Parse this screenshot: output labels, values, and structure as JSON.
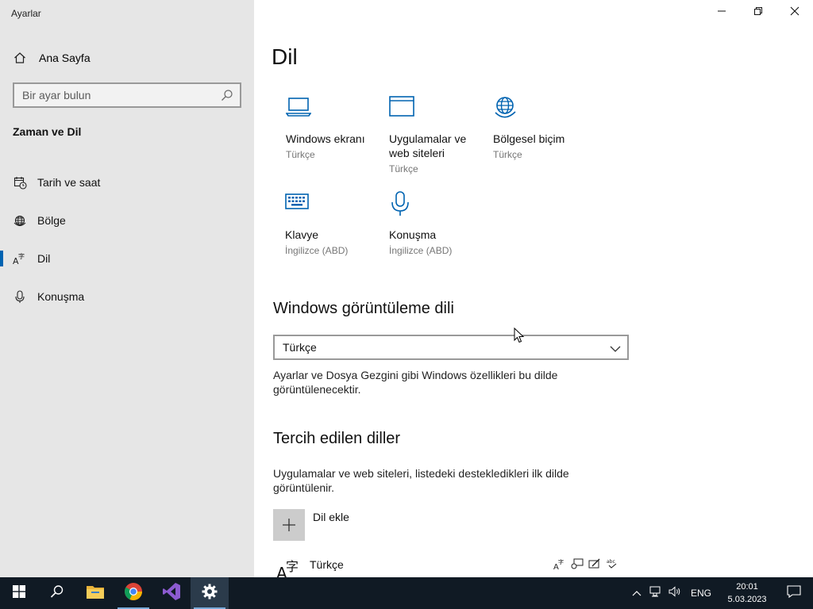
{
  "window": {
    "app_title": "Ayarlar",
    "controls": {
      "minimize_icon": "minimize-icon",
      "restore_icon": "restore-icon",
      "close_icon": "close-icon"
    }
  },
  "sidebar": {
    "home_label": "Ana Sayfa",
    "search_placeholder": "Bir ayar bulun",
    "section_title": "Zaman ve Dil",
    "items": [
      {
        "label": "Tarih ve saat",
        "icon": "date-time-icon",
        "active": false
      },
      {
        "label": "Bölge",
        "icon": "region-globe-icon",
        "active": false
      },
      {
        "label": "Dil",
        "icon": "language-icon",
        "active": true
      },
      {
        "label": "Konuşma",
        "icon": "microphone-icon",
        "active": false
      }
    ]
  },
  "main": {
    "title": "Dil",
    "tiles": [
      {
        "label": "Windows ekranı",
        "sub": "Türkçe",
        "icon": "laptop-icon"
      },
      {
        "label": "Uygulamalar ve web siteleri",
        "sub": "Türkçe",
        "icon": "app-window-icon"
      },
      {
        "label": "Bölgesel biçim",
        "sub": "Türkçe",
        "icon": "region-globe-icon"
      },
      {
        "label": "Klavye",
        "sub": "İngilizce (ABD)",
        "icon": "keyboard-icon"
      },
      {
        "label": "Konuşma",
        "sub": "İngilizce (ABD)",
        "icon": "microphone-icon"
      }
    ],
    "display_language": {
      "heading": "Windows görüntüleme dili",
      "selected": "Türkçe",
      "description": "Ayarlar ve Dosya Gezgini gibi Windows özellikleri bu dilde görüntülenecektir."
    },
    "preferred_languages": {
      "heading": "Tercih edilen diller",
      "description": "Uygulamalar ve web siteleri, listedeki destekledikleri ilk dilde görüntülenir.",
      "add_label": "Dil ekle",
      "languages": [
        {
          "name": "Türkçe",
          "features": [
            "display-language-icon",
            "speech-icon",
            "handwriting-icon",
            "spellcheck-icon"
          ]
        }
      ]
    }
  },
  "taskbar": {
    "apps": [
      "windows-start-icon",
      "search-icon",
      "file-explorer-icon",
      "chrome-icon",
      "visual-studio-icon",
      "settings-icon"
    ],
    "tray": {
      "language": "ENG",
      "time": "20:01",
      "date": "5.03.2023"
    }
  },
  "colors": {
    "accent": "#0063b1",
    "sidebar_bg": "#e6e6e6",
    "taskbar_bg": "#101a24",
    "secondary_text": "#767676"
  }
}
